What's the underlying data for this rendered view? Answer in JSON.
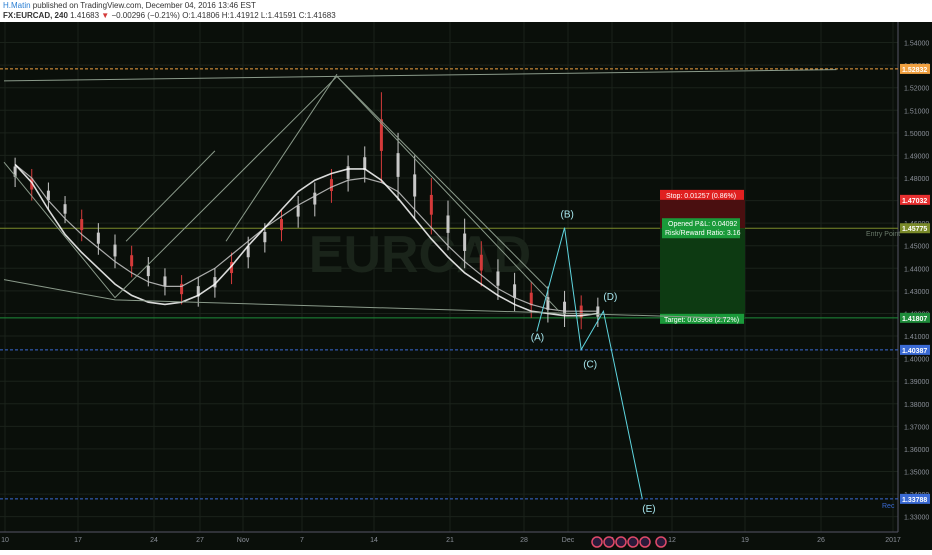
{
  "header": {
    "author": "H.Matin",
    "published": "published on TradingView.com, December 04, 2016 13:46 EST",
    "symbol": "FX:EURCAD, 240",
    "last": "1.41683",
    "change_arrow": "▼",
    "change": "−0.00296 (−0.21%)",
    "ohlc": "O:1.41806 H:1.41912 L:1.41591 C:1.41683"
  },
  "chart_data": {
    "type": "line",
    "title": "",
    "watermark": "EURCAD",
    "ylim": [
      1.3232,
      1.5491
    ],
    "y_ticks": [
      "1.54000",
      "1.53000",
      "1.52000",
      "1.51000",
      "1.50000",
      "1.49000",
      "1.48000",
      "1.47000",
      "1.46000",
      "1.45000",
      "1.44000",
      "1.43000",
      "1.42000",
      "1.41000",
      "1.40000",
      "1.39000",
      "1.38000",
      "1.37000",
      "1.36000",
      "1.35000",
      "1.34000",
      "1.33000"
    ],
    "x_ticks": [
      "10",
      "17",
      "24",
      "27",
      "Nov",
      "7",
      "14",
      "21",
      "28",
      "Dec",
      "6",
      "12",
      "19",
      "26",
      "2017"
    ],
    "price_levels": [
      {
        "label": "1.52832",
        "value": 1.52832,
        "color": "#f0a040"
      },
      {
        "label": "1.47032",
        "value": 1.47032,
        "color": "#e83030"
      },
      {
        "label": "1.45775",
        "value": 1.45775,
        "color": "#7a8a2a"
      },
      {
        "label": "1.41807",
        "value": 1.41807,
        "color": "#1e8c3a"
      },
      {
        "label": "1.40387",
        "value": 1.40387,
        "color": "#3a6ad4"
      },
      {
        "label": "1.33788",
        "value": 1.33788,
        "color": "#3a6ad4"
      }
    ],
    "line_labels": {
      "entry": "Entry Point",
      "rec": "Rec"
    },
    "position_tool": {
      "stop": "Stop: 0.01257 (0.86%)",
      "pnl": "Opened P&L: 0.04092",
      "rr": "Risk/Reward Ratio: 3.16",
      "target": "Target: 0.03968 (2.72%)"
    },
    "wave_labels": [
      "(A)",
      "(B)",
      "(C)",
      "(D)",
      "(E)"
    ],
    "series": [
      {
        "values": [
          1.486,
          1.48,
          1.47,
          1.462,
          1.455,
          1.449,
          1.443,
          1.438,
          1.434,
          1.432,
          1.432,
          1.436,
          1.44,
          1.446,
          1.452,
          1.458,
          1.463,
          1.468,
          1.472,
          1.476,
          1.479,
          1.48,
          1.478,
          1.474,
          1.466,
          1.458,
          1.45,
          1.443,
          1.437,
          1.431,
          1.427,
          1.424,
          1.422,
          1.421,
          1.421,
          1.421
        ],
        "color": "#c8c8c8"
      },
      {
        "values": [
          1.486,
          1.478,
          1.466,
          1.455,
          1.447,
          1.44,
          1.433,
          1.428,
          1.425,
          1.424,
          1.425,
          1.428,
          1.433,
          1.441,
          1.45,
          1.458,
          1.466,
          1.474,
          1.479,
          1.482,
          1.484,
          1.484,
          1.479,
          1.471,
          1.462,
          1.453,
          1.445,
          1.438,
          1.433,
          1.428,
          1.424,
          1.421,
          1.42,
          1.419,
          1.419,
          1.42
        ],
        "color": "#ffffff"
      }
    ],
    "candles": [
      [
        1.489,
        1.476
      ],
      [
        1.484,
        1.47
      ],
      [
        1.478,
        1.466
      ],
      [
        1.472,
        1.46
      ],
      [
        1.466,
        1.452
      ],
      [
        1.46,
        1.446
      ],
      [
        1.455,
        1.44
      ],
      [
        1.45,
        1.436
      ],
      [
        1.445,
        1.432
      ],
      [
        1.44,
        1.428
      ],
      [
        1.437,
        1.424
      ],
      [
        1.436,
        1.423
      ],
      [
        1.44,
        1.427
      ],
      [
        1.447,
        1.433
      ],
      [
        1.454,
        1.44
      ],
      [
        1.46,
        1.447
      ],
      [
        1.466,
        1.452
      ],
      [
        1.472,
        1.458
      ],
      [
        1.478,
        1.463
      ],
      [
        1.484,
        1.469
      ],
      [
        1.49,
        1.474
      ],
      [
        1.494,
        1.478
      ],
      [
        1.518,
        1.478
      ],
      [
        1.5,
        1.47
      ],
      [
        1.49,
        1.462
      ],
      [
        1.48,
        1.455
      ],
      [
        1.47,
        1.448
      ],
      [
        1.462,
        1.44
      ],
      [
        1.452,
        1.432
      ],
      [
        1.444,
        1.426
      ],
      [
        1.438,
        1.421
      ],
      [
        1.434,
        1.418
      ],
      [
        1.432,
        1.416
      ],
      [
        1.43,
        1.414
      ],
      [
        1.428,
        1.413
      ],
      [
        1.427,
        1.414
      ]
    ],
    "trendlines": [
      [
        [
          0,
          1.487
        ],
        [
          20,
          1.427
        ],
        [
          60,
          1.525
        ],
        [
          100,
          1.421
        ]
      ],
      [
        [
          0,
          1.435
        ],
        [
          20,
          1.426
        ],
        [
          130,
          1.418
        ]
      ],
      [
        [
          0,
          1.523
        ],
        [
          150,
          1.528
        ]
      ],
      [
        [
          40,
          1.452
        ],
        [
          60,
          1.526
        ]
      ],
      [
        [
          22,
          1.452
        ],
        [
          38,
          1.492
        ]
      ],
      [
        [
          60,
          1.525
        ],
        [
          98,
          1.431
        ]
      ],
      [
        [
          96,
          1.412
        ],
        [
          101,
          1.458
        ],
        [
          104,
          1.404
        ],
        [
          108,
          1.421
        ],
        [
          115,
          1.338
        ]
      ]
    ]
  }
}
